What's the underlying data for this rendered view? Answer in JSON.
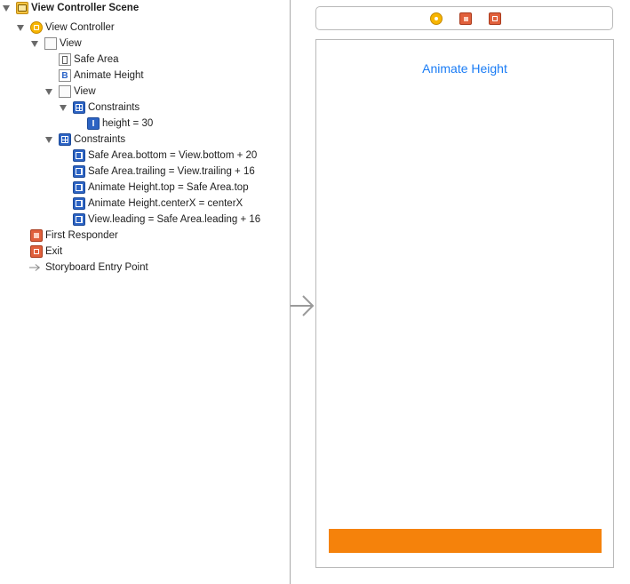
{
  "outline": {
    "items": [
      {
        "label": "View Controller Scene",
        "icon": "scene-icon",
        "bold": true
      },
      {
        "label": "View Controller",
        "icon": "view-controller-icon"
      },
      {
        "label": "View",
        "icon": "view-icon"
      },
      {
        "label": "Safe Area",
        "icon": "safe-area-icon"
      },
      {
        "label": "Animate Height",
        "icon": "button-icon"
      },
      {
        "label": "View",
        "icon": "view-icon"
      },
      {
        "label": "Constraints",
        "icon": "constraints-icon"
      },
      {
        "label": "height = 30",
        "icon": "height-constraint-icon"
      },
      {
        "label": "Constraints",
        "icon": "constraints-icon"
      },
      {
        "label": "Safe Area.bottom = View.bottom + 20",
        "icon": "constraint-icon"
      },
      {
        "label": "Safe Area.trailing = View.trailing + 16",
        "icon": "constraint-icon"
      },
      {
        "label": "Animate Height.top = Safe Area.top",
        "icon": "constraint-icon"
      },
      {
        "label": "Animate Height.centerX = centerX",
        "icon": "constraint-icon"
      },
      {
        "label": "View.leading = Safe Area.leading + 16",
        "icon": "constraint-icon"
      },
      {
        "label": "First Responder",
        "icon": "first-responder-icon"
      },
      {
        "label": "Exit",
        "icon": "exit-icon"
      },
      {
        "label": "Storyboard Entry Point",
        "icon": "entry-point-arrow-icon"
      }
    ]
  },
  "canvas": {
    "button_title": "Animate Height",
    "accent_color": "#1a7cf5",
    "orange_view_color": "#f5820b"
  }
}
